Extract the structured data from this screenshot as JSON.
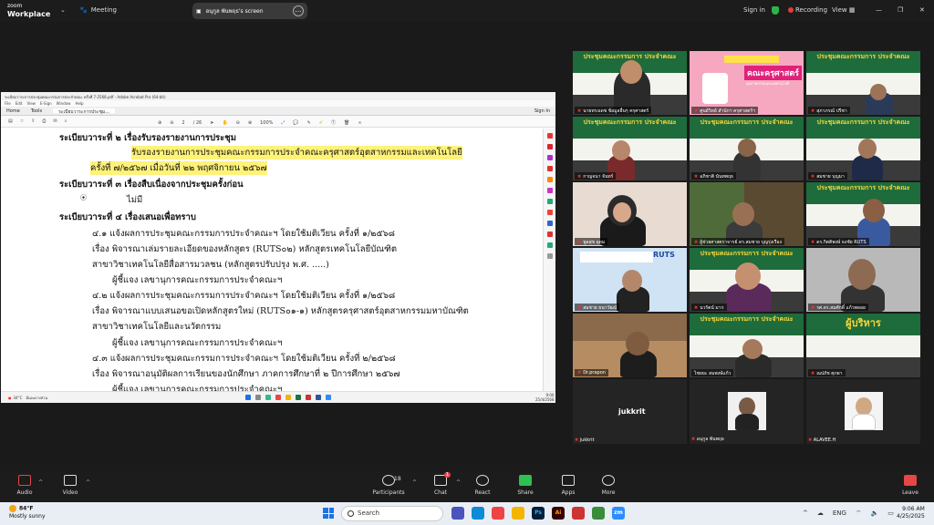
{
  "topbar": {
    "logo_line1": "zoom",
    "logo_line2": "Workplace",
    "meeting_label": "Meeting",
    "share_label": "อนุกูล พันพฤธ's screen",
    "signin": "Sign in",
    "recording": "Recording",
    "view": "View"
  },
  "acrobat": {
    "title": "ระเบียบวาระการประชุมคณะกรรมการประจำคณะ ครั้งที่ 7-2568.pdf - Adobe Acrobat Pro (64-bit)",
    "menu": [
      "File",
      "Edit",
      "View",
      "E-Sign",
      "Window",
      "Help"
    ],
    "tabs": [
      "Home",
      "Tools",
      "ระเบียบวาระการประชุม..."
    ],
    "signin": "Sign In",
    "page_current": "2",
    "page_total": "/ 26",
    "zoom": "100%"
  },
  "document": {
    "agenda2_heading": "ระเบียบวาระที่   ๒   เรื่องรับรองรายงานการประชุม",
    "agenda2_line1": "รับรองรายงานการประชุมคณะกรรมการประจำคณะครุศาสตร์อุตสาหกรรมและเทคโนโลยี",
    "agenda2_line2": "ครั้งที่ ๗/๒๕๖๗ เมื่อวันที่ ๒๒ พฤศจิกายน ๒๕๖๗",
    "agenda3_heading": "ระเบียบวาระที่   ๓   เรื่องสืบเนื่องจากประชุมครั้งก่อน",
    "agenda3_bullet": "ไม่มี",
    "agenda4_heading": "ระเบียบวาระที่   ๔   เรื่องเสนอเพื่อทราบ",
    "item41_a": "๔.๑ แจ้งผลการประชุมคณะกรรมการประจำคณะฯ โดยใช้มติเวียน ครั้งที่ ๑/๒๕๖๘",
    "item41_b": "เรื่อง  พิจารณาเล่มรายละเอียดของหลักสูตร (RUTS๐๒) หลักสูตรเทคโนโลยีบัณฑิต",
    "item41_c": "สาขาวิชาเทคโนโลยีสื่อสารมวลชน (หลักสูตรปรับปรุง พ.ศ. .....)",
    "item41_d": "ผู้ชี้แจง เลขานุการคณะกรรมการประจำคณะฯ",
    "item42_a": "๔.๒ แจ้งผลการประชุมคณะกรรมการประจำคณะฯ โดยใช้มติเวียน ครั้งที่ ๑/๒๕๖๘",
    "item42_b": "เรื่อง  พิจารณาแบบเสนอขอเปิดหลักสูตรใหม่ (RUTS๐๑-๑) หลักสูตรครุศาสตร์อุตสาหกรรมมหาบัณฑิต",
    "item42_c": "สาขาวิชาเทคโนโลยีและนวัตกรรม",
    "item42_d": "ผู้ชี้แจง เลขานุการคณะกรรมการประจำคณะฯ",
    "item43_a": "๔.๓ แจ้งผลการประชุมคณะกรรมการประจำคณะฯ โดยใช้มติเวียน ครั้งที่ ๒/๒๕๖๘",
    "item43_b": "เรื่อง  พิจารณาอนุมัติผลการเรียนของนักศึกษา ภาคการศึกษาที่ ๒ ปีการศึกษา ๒๕๖๗",
    "item43_c": "ผู้ชี้แจง เลขานุการคณะกรรมการประจำคณะฯ"
  },
  "inner_taskbar": {
    "weather": "34°C",
    "weather_sub": "มีเมฆบางส่วน",
    "time": "9:06",
    "date": "25/4/2568"
  },
  "gallery": {
    "banner_text": "ประชุมคณะกรรมการ ประจำคณะ",
    "featured_text": "คณะครุศาสตร์",
    "featured_sub": "อุตสาหกรรมและเทคโนโลยี",
    "admin_banner": "ผู้บริหาร",
    "logo_text": "RUTS",
    "names": [
      "นายทรงเดช ข้อมูลอื่นๆ ครุศาสตร์",
      "ศูนย์วิทย์ สำนักฯ ครุศาสตร์ฯ",
      "สุภาภรณ์ ปรีชา",
      "กาญจนา จันทร์",
      "อภิชาติ นันทพฤธ",
      "สมชาย บุญมา",
      "พูลสุข อุดม",
      "ผู้ช่วยศาสตราจารย์ ดร.สมชาย บุญรุ่งเรือง",
      "ดร.กิตติพงษ์ ธงชัย RUTS",
      "สมชาย ธนาวัฒน์",
      "นวรัตน์ มาก",
      "รศ.ดร.สมศักดิ์ แก้วพลอย",
      "Dr.prapon",
      "ไชยยะ สมพงษ์แก้ว",
      "ณปภัช ศุภยา",
      "jukkrit",
      "อนุกูล พันพฤธ",
      "ALAVEE.H"
    ],
    "big_name": "jukkrit"
  },
  "controls": {
    "audio": "Audio",
    "video": "Video",
    "participants": "Participants",
    "participants_count": "18",
    "chat": "Chat",
    "chat_badge": "1",
    "react": "React",
    "share": "Share",
    "apps": "Apps",
    "more": "More",
    "leave": "Leave"
  },
  "windows": {
    "temp": "84°F",
    "weather": "Mostly sunny",
    "search": "Search",
    "lang": "ENG",
    "time": "9:06 AM",
    "date": "4/25/2025"
  }
}
